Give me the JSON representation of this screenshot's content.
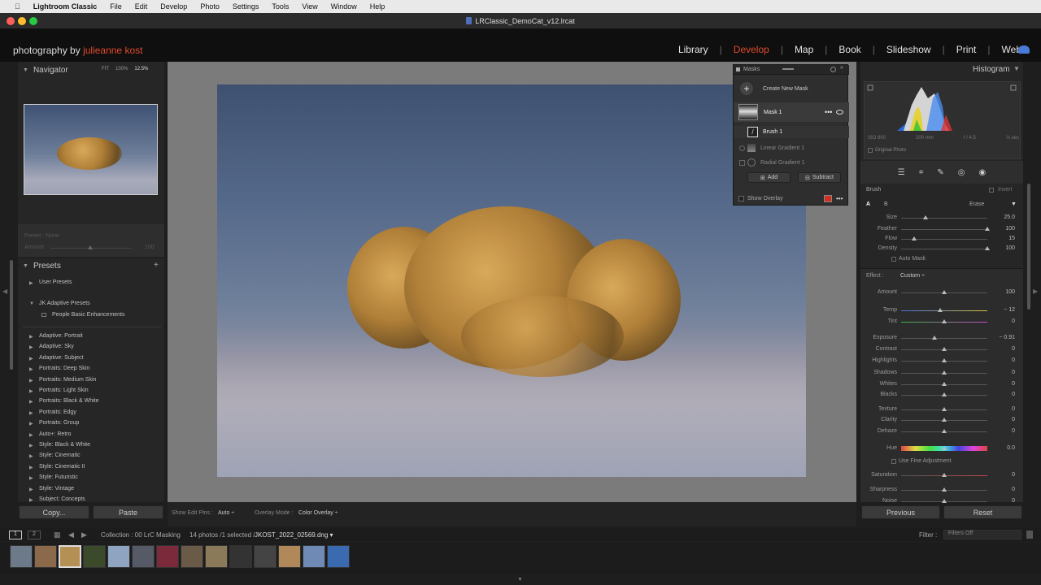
{
  "menubar": {
    "app": "Lightroom Classic",
    "items": [
      "File",
      "Edit",
      "Develop",
      "Photo",
      "Settings",
      "Tools",
      "View",
      "Window",
      "Help"
    ]
  },
  "window": {
    "title": "LRClassic_DemoCat_v12.lrcat"
  },
  "identity": {
    "prefix": "photography by ",
    "name": "julieanne kost"
  },
  "modules": [
    "Library",
    "Develop",
    "Map",
    "Book",
    "Slideshow",
    "Print",
    "Web"
  ],
  "modules_active": "Develop",
  "navigator": {
    "title": "Navigator",
    "zoom": [
      "FIT",
      "100%",
      "12.5%"
    ]
  },
  "preset_amount": {
    "label": "Preset : None",
    "amount_label": "Amount",
    "amount_value": "100"
  },
  "presets": {
    "title": "Presets",
    "groups": [
      "User Presets",
      "JK Adaptive Presets"
    ],
    "sub_item": "People Basic Enhancements",
    "items": [
      "Adaptive: Portrait",
      "Adaptive: Sky",
      "Adaptive: Subject",
      "Portraits: Deep Skin",
      "Portraits: Medium Skin",
      "Portraits: Light Skin",
      "Portraits: Black & White",
      "Portraits: Edgy",
      "Portraits: Group",
      "Auto+: Retro",
      "Style: Black & White",
      "Style: Cinematic",
      "Style: Cinematic II",
      "Style: Futuristic",
      "Style: Vintage",
      "Subject: Concepts"
    ]
  },
  "left_buttons": {
    "copy": "Copy...",
    "paste": "Paste"
  },
  "toolbar": {
    "pins_label": "Show Edit Pins :",
    "pins_value": "Auto",
    "overlay_label": "Overlay Mode :",
    "overlay_value": "Color Overlay"
  },
  "masks": {
    "title": "Masks",
    "create": "Create New Mask",
    "mask1": "Mask 1",
    "brush1": "Brush 1",
    "linear": "Linear Gradient 1",
    "radial": "Radial Gradient 1",
    "add": "Add",
    "subtract": "Subtract",
    "show_overlay": "Show Overlay",
    "overlay_color": "#d62d20"
  },
  "histogram": {
    "title": "Histogram",
    "iso": "ISO 800",
    "focal": "200 mm",
    "aperture": "f / 4.5",
    "shutter": "⅓ sec",
    "original": "Original Photo"
  },
  "brush": {
    "title": "Brush",
    "invert": "Invert",
    "a": "A",
    "b": "B",
    "erase": "Erase",
    "size": {
      "label": "Size",
      "value": "25.0",
      "pos": 0.28
    },
    "feather": {
      "label": "Feather",
      "value": "100",
      "pos": 1
    },
    "flow": {
      "label": "Flow",
      "value": "15",
      "pos": 0.15
    },
    "density": {
      "label": "Density",
      "value": "100",
      "pos": 1
    },
    "automask": "Auto Mask"
  },
  "effect": {
    "label": "Effect :",
    "preset": "Custom",
    "sliders": [
      {
        "label": "Amount",
        "value": "100",
        "pos": 0.5
      },
      {
        "label": "Temp",
        "value": "− 12",
        "pos": 0.45
      },
      {
        "label": "Tint",
        "value": "0",
        "pos": 0.5
      },
      {
        "label": "Exposure",
        "value": "− 0.91",
        "pos": 0.39
      },
      {
        "label": "Contrast",
        "value": "0",
        "pos": 0.5
      },
      {
        "label": "Highlights",
        "value": "0",
        "pos": 0.5
      },
      {
        "label": "Shadows",
        "value": "0",
        "pos": 0.5
      },
      {
        "label": "Whites",
        "value": "0",
        "pos": 0.5
      },
      {
        "label": "Blacks",
        "value": "0",
        "pos": 0.5
      },
      {
        "label": "Texture",
        "value": "0",
        "pos": 0.5
      },
      {
        "label": "Clarity",
        "value": "0",
        "pos": 0.5
      },
      {
        "label": "Dehaze",
        "value": "0",
        "pos": 0.5
      },
      {
        "label": "Hue",
        "value": "0.0",
        "pos": 0.5
      },
      {
        "label": "Saturation",
        "value": "0",
        "pos": 0.5
      },
      {
        "label": "Sharpness",
        "value": "0",
        "pos": 0.5
      },
      {
        "label": "Noise",
        "value": "0",
        "pos": 0.5
      }
    ],
    "fine_adjust": "Use Fine Adjustment"
  },
  "right_buttons": {
    "previous": "Previous",
    "reset": "Reset"
  },
  "filmhead": {
    "pages": [
      "1",
      "2"
    ],
    "collection": "Collection : 00 LrC Masking",
    "count": "14 photos /1 selected /",
    "file": "JKOST_2022_02569.dng",
    "filter_label": "Filter :",
    "filter_value": "Filters Off"
  },
  "thumbs": [
    "#6d7a8a",
    "#8a6a4a",
    "#b59055",
    "#3a4a2a",
    "#8fa4c0",
    "#555a66",
    "#7a2a3a",
    "#6a5a48",
    "#8a7a5a",
    "#333",
    "#444",
    "#b0885a",
    "#6f8bb5",
    "#3a6ab0"
  ]
}
